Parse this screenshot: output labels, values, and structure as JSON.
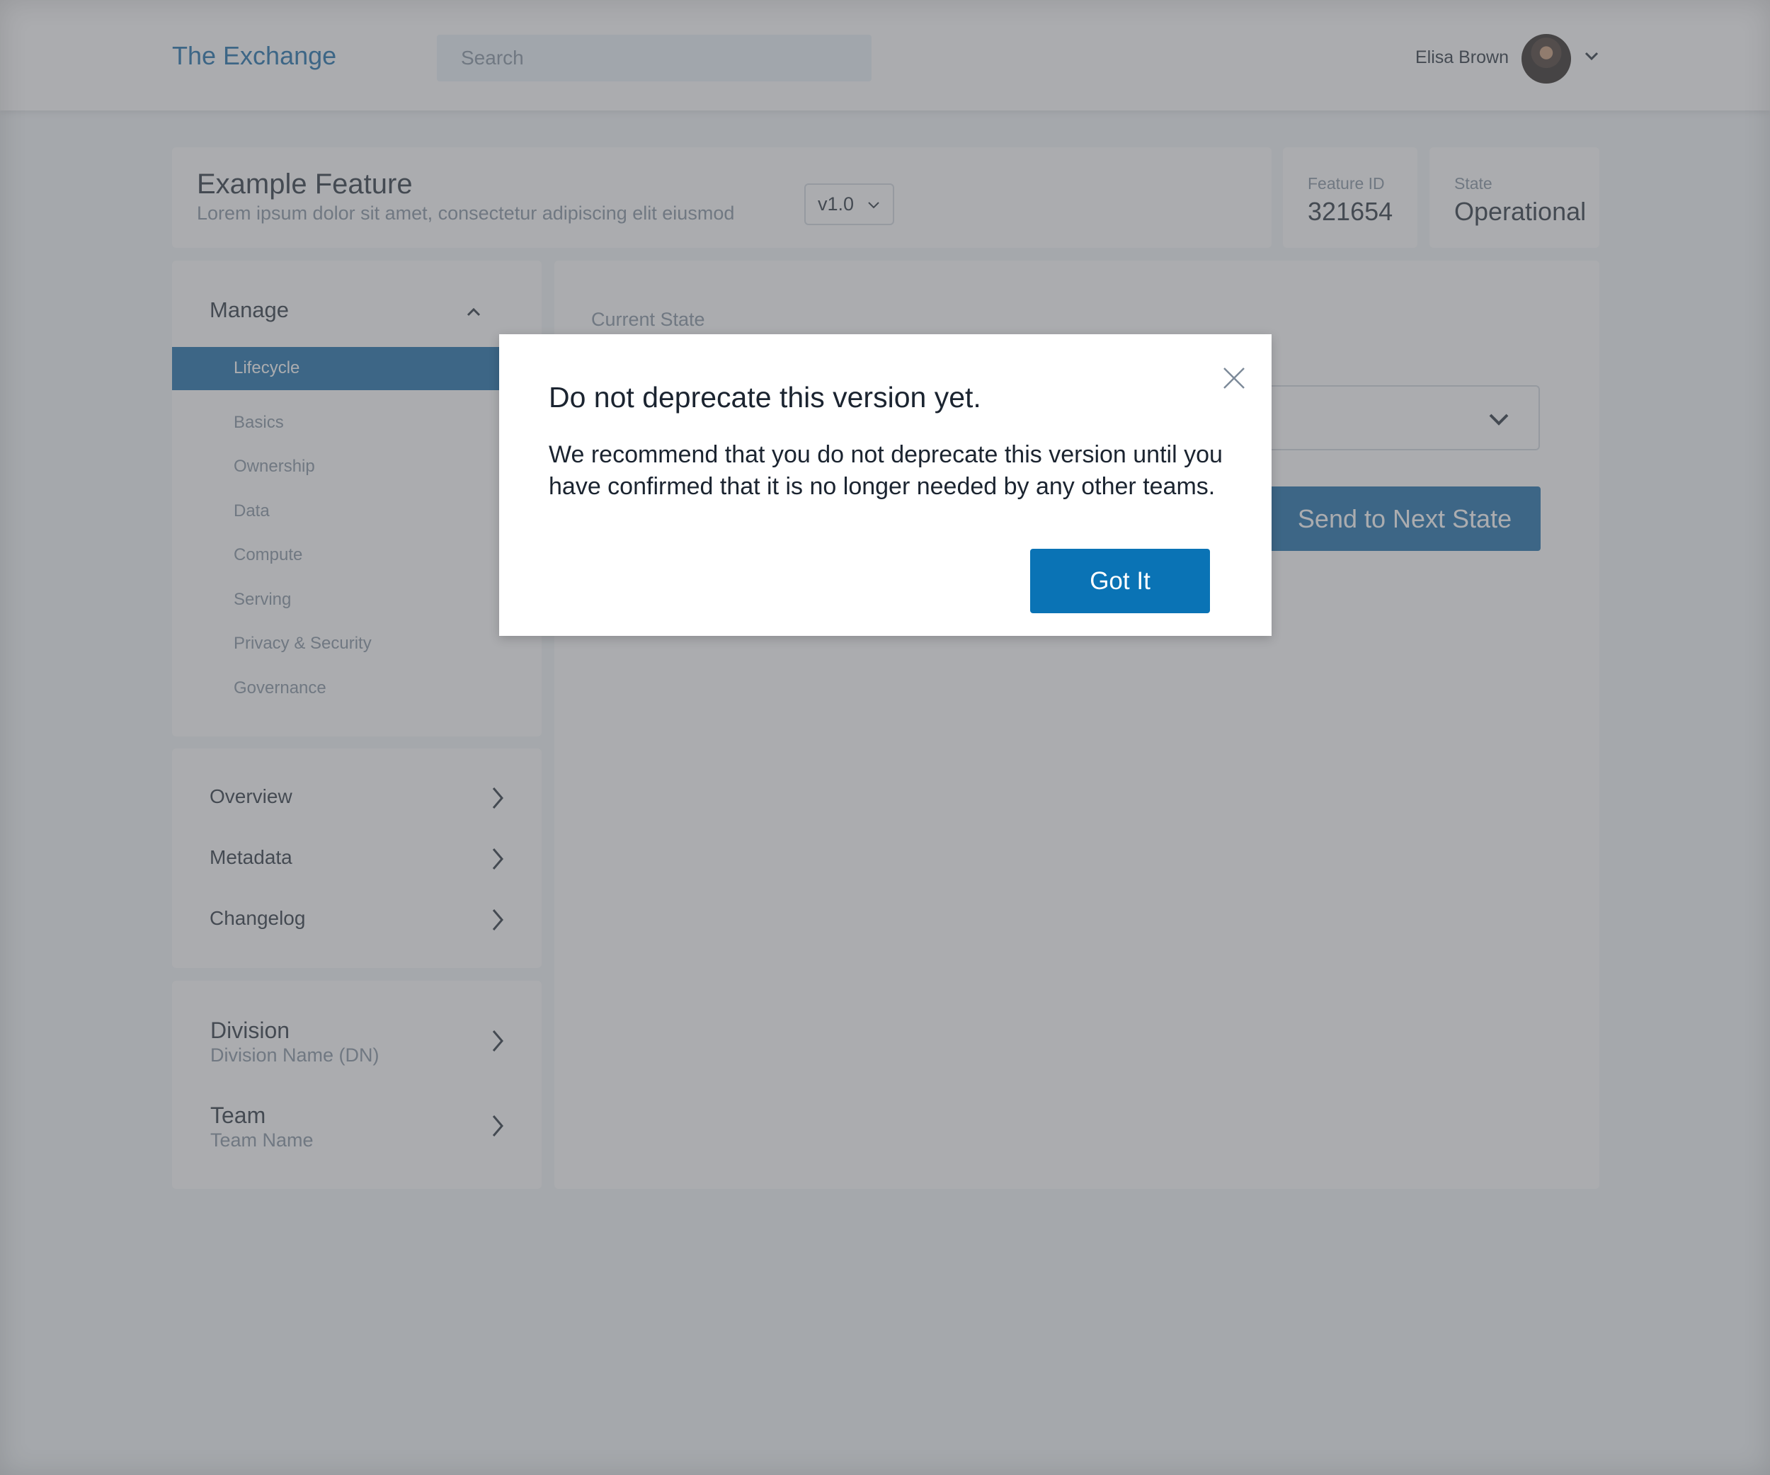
{
  "header": {
    "brand": "The Exchange",
    "search_placeholder": "Search",
    "user_name": "Elisa Brown"
  },
  "feature": {
    "title": "Example Feature",
    "description": "Lorem ipsum dolor sit amet, consectetur adipiscing elit eiusmod",
    "version": "v1.0",
    "id_label": "Feature ID",
    "id_value": "321654",
    "state_label": "State",
    "state_value": "Operational"
  },
  "sidebar": {
    "manage_label": "Manage",
    "active_item": "Lifecycle",
    "items": [
      "Basics",
      "Ownership",
      "Data",
      "Compute",
      "Serving",
      "Privacy & Security",
      "Governance"
    ],
    "links": [
      "Overview",
      "Metadata",
      "Changelog"
    ],
    "division_title": "Division",
    "division_name": "Division Name (DN)",
    "team_title": "Team",
    "team_name": "Team Name"
  },
  "main": {
    "current_state_label": "Current State",
    "next_button": "Send to Next State"
  },
  "modal": {
    "title": "Do not deprecate this version yet.",
    "body": "We recommend that you do not deprecate this version until you have confirmed that it is no longer needed by any other teams.",
    "button": "Got It"
  },
  "colors": {
    "accent": "#0a63a3",
    "modal_button": "#0a73b5",
    "text_primary": "#1b2430",
    "text_muted": "#7d8a99"
  }
}
